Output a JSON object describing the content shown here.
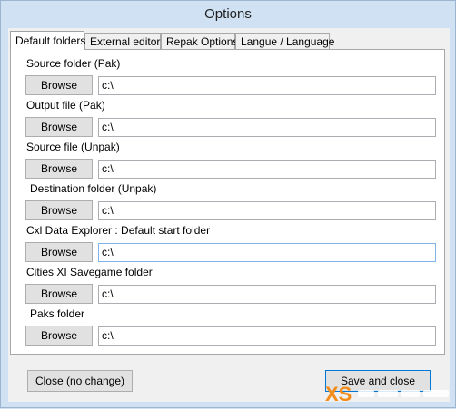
{
  "window": {
    "title": "Options"
  },
  "tabs": [
    {
      "label": "Default folders"
    },
    {
      "label": "External editors"
    },
    {
      "label": "Repak Options"
    },
    {
      "label": "Langue / Language"
    }
  ],
  "folders": [
    {
      "label": "Source folder (Pak)",
      "button": "Browse",
      "value": "c:\\"
    },
    {
      "label": "Output file (Pak)",
      "button": "Browse",
      "value": "c:\\"
    },
    {
      "label": "Source file (Unpak)",
      "button": "Browse",
      "value": "c:\\"
    },
    {
      "label": "Destination folder (Unpak)",
      "button": "Browse",
      "value": "c:\\"
    },
    {
      "label": "Cxl Data Explorer : Default start folder",
      "button": "Browse",
      "value": "c:\\"
    },
    {
      "label": "Cities XI Savegame folder",
      "button": "Browse",
      "value": "c:\\"
    },
    {
      "label": "Paks folder",
      "button": "Browse",
      "value": "c:\\"
    }
  ],
  "footer": {
    "close_label": "Close (no change)",
    "save_label": "Save and close"
  },
  "watermark": {
    "logo_text": "XS"
  }
}
